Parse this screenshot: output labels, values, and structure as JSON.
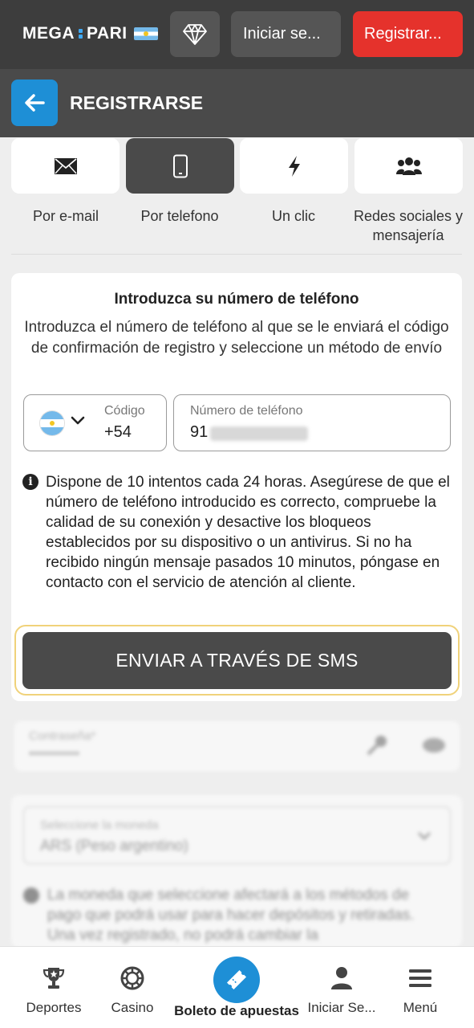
{
  "header": {
    "logo": "MEGA",
    "logo_part2": "PARI",
    "login_label": "Iniciar se...",
    "register_label": "Registrar..."
  },
  "title_bar": {
    "title": "REGISTRARSE"
  },
  "methods": [
    {
      "label": "Por e-mail",
      "icon": "envelope-icon",
      "active": false
    },
    {
      "label": "Por telefono",
      "icon": "phone-icon",
      "active": true
    },
    {
      "label": "Un clic",
      "icon": "lightning-icon",
      "active": false
    },
    {
      "label": "Redes sociales y mensajería",
      "icon": "users-icon",
      "active": false
    }
  ],
  "phone_form": {
    "heading": "Introduzca su número de teléfono",
    "description": "Introduzca el número de teléfono al que se le enviará el código de confirmación de registro y seleccione un método de envío",
    "code_label": "Código",
    "code_value": "+54",
    "phone_label": "Número de teléfono",
    "phone_value": "91",
    "info": "Dispone de 10 intentos cada 24 horas. Asegúrese de que el número de teléfono introducido es correcto, compruebe la calidad de su conexión y desactive los bloqueos establecidos por su dispositivo o un antivirus. Si no ha recibido ningún mensaje pasados 10 minutos, póngase en contacto con el servicio de atención al cliente.",
    "send_button": "ENVIAR A TRAVÉS DE SMS"
  },
  "bottom_nav": {
    "items": [
      {
        "label": "Deportes",
        "icon": "trophy-icon"
      },
      {
        "label": "Casino",
        "icon": "casino-chip-icon"
      },
      {
        "label": "Boleto de apuestas",
        "icon": "ticket-icon"
      },
      {
        "label": "Iniciar Se...",
        "icon": "user-icon"
      },
      {
        "label": "Menú",
        "icon": "hamburger-icon"
      }
    ]
  },
  "colors": {
    "header_bg": "#3d3d3d",
    "register_red": "#e5322c",
    "accent_blue": "#1e8fd6",
    "highlight_yellow": "#f0d27a"
  }
}
